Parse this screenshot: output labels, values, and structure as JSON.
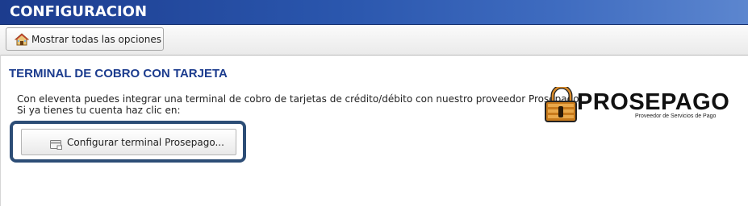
{
  "header": {
    "title": "CONFIGURACION"
  },
  "toolbar": {
    "show_all_label": "Mostrar todas las opciones",
    "icon": "home-icon"
  },
  "section": {
    "title": "TERMINAL DE COBRO CON TARJETA",
    "description_line1": "Con eleventa puedes integrar una terminal de cobro de tarjetas de crédito/débito con nuestro proveedor Prosepago.",
    "description_line2": "Si ya tienes tu cuenta haz clic en:",
    "configure_button_label": "Configurar terminal Prosepago...",
    "configure_icon": "card-icon"
  },
  "logo": {
    "name": "PROSEPAGO",
    "tagline": "Proveedor de Servicios de Pago",
    "colors": {
      "lock": "#c77a1c",
      "text": "#111111"
    }
  },
  "colors": {
    "header_bg": "#2a56ad",
    "title_blue": "#1c3c8e",
    "frame_border": "#2c4d76"
  }
}
